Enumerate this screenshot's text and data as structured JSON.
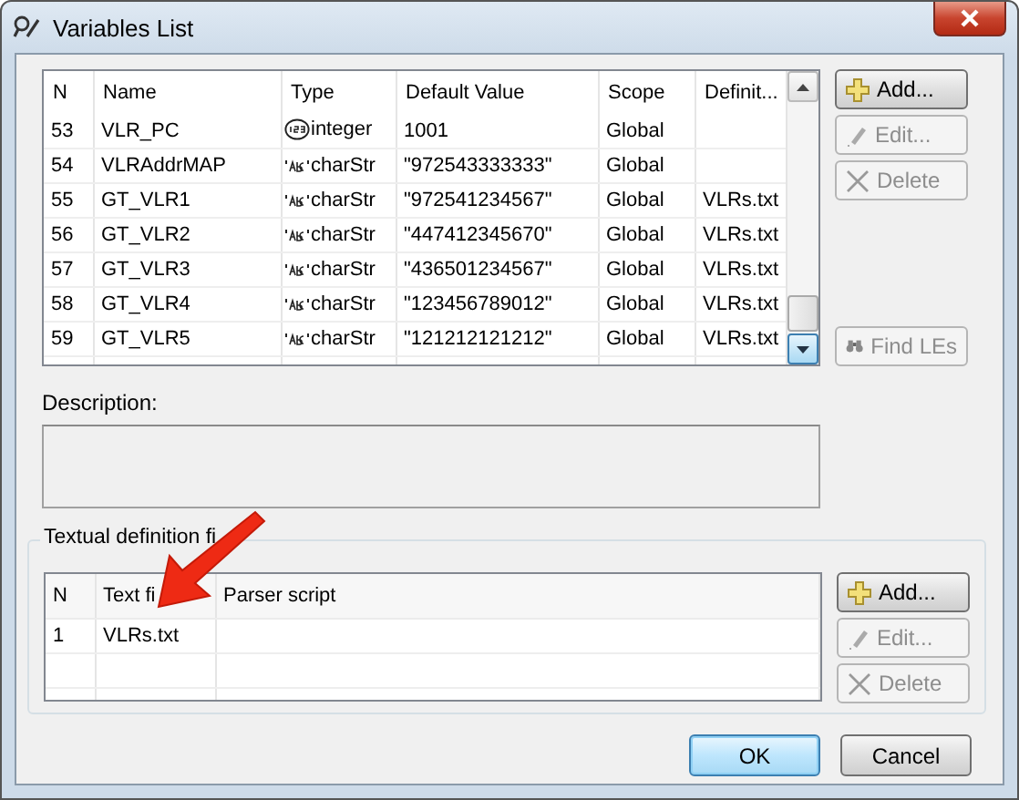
{
  "window": {
    "title": "Variables List"
  },
  "variables": {
    "columns": [
      "N",
      "Name",
      "Type",
      "Default Value",
      "Scope",
      "Definit..."
    ],
    "rows": [
      {
        "n": "53",
        "name": "VLR_PC",
        "kind": "number",
        "type": "integer",
        "default": "1001",
        "scope": "Global",
        "definition": ""
      },
      {
        "n": "54",
        "name": "VLRAddrMAP",
        "kind": "text",
        "type": "charStr",
        "default": "\"972543333333\"",
        "scope": "Global",
        "definition": ""
      },
      {
        "n": "55",
        "name": "GT_VLR1",
        "kind": "text",
        "type": "charStr",
        "default": "\"972541234567\"",
        "scope": "Global",
        "definition": "VLRs.txt"
      },
      {
        "n": "56",
        "name": "GT_VLR2",
        "kind": "text",
        "type": "charStr",
        "default": "\"447412345670\"",
        "scope": "Global",
        "definition": "VLRs.txt"
      },
      {
        "n": "57",
        "name": "GT_VLR3",
        "kind": "text",
        "type": "charStr",
        "default": "\"436501234567\"",
        "scope": "Global",
        "definition": "VLRs.txt"
      },
      {
        "n": "58",
        "name": "GT_VLR4",
        "kind": "text",
        "type": "charStr",
        "default": "\"123456789012\"",
        "scope": "Global",
        "definition": "VLRs.txt"
      },
      {
        "n": "59",
        "name": "GT_VLR5",
        "kind": "text",
        "type": "charStr",
        "default": "\"121212121212\"",
        "scope": "Global",
        "definition": "VLRs.txt"
      }
    ],
    "buttons": [
      {
        "kind": "add",
        "label": "Add...",
        "disabled": false
      },
      {
        "kind": "edit",
        "label": "Edit...",
        "disabled": true
      },
      {
        "kind": "delete",
        "label": "Delete",
        "disabled": true
      }
    ],
    "find_button": {
      "label": "Find LEs",
      "disabled": true
    }
  },
  "description": {
    "label": "Description:"
  },
  "files": {
    "group_label": "Textual definition fi",
    "columns": [
      "N",
      "Text fi",
      "Parser script"
    ],
    "rows": [
      {
        "n": "1",
        "file": "VLRs.txt",
        "parser": ""
      }
    ],
    "buttons": [
      {
        "kind": "add",
        "label": "Add...",
        "disabled": false
      },
      {
        "kind": "edit",
        "label": "Edit...",
        "disabled": true
      },
      {
        "kind": "delete",
        "label": "Delete",
        "disabled": true
      }
    ]
  },
  "footer": [
    {
      "label": "OK",
      "default": true
    },
    {
      "label": "Cancel",
      "default": false
    }
  ]
}
